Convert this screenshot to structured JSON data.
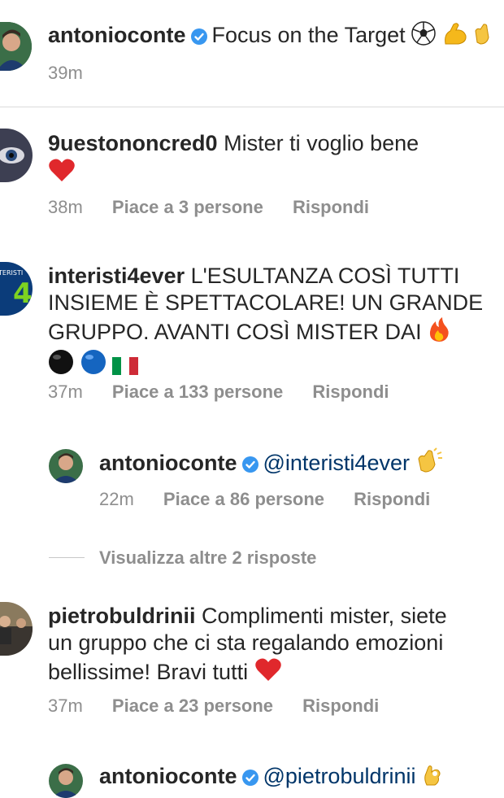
{
  "caption": {
    "username": "antonioconte",
    "text": "Focus on the Target",
    "time": "39m"
  },
  "comments": [
    {
      "username": "9uestononcred0",
      "text": "Mister ti voglio bene",
      "time": "38m",
      "likes": "Piace a 3 persone",
      "reply": "Rispondi"
    },
    {
      "username": "interisti4ever",
      "line1": "L'ESULTANZA COSÌ TUTTI",
      "line2": "INSIEME È SPETTACOLARE! UN GRANDE",
      "line3": "GRUPPO. AVANTI COSÌ MISTER DAI",
      "time": "37m",
      "likes": "Piace a 133 persone",
      "reply": "Rispondi"
    },
    {
      "username": "antonioconte",
      "mention": "@interisti4ever",
      "time": "22m",
      "likes": "Piace a 86 persone",
      "reply": "Rispondi"
    },
    {
      "username": "pietrobuldrinii",
      "line1": "Complimenti mister, siete",
      "line2": "un gruppo che ci sta regalando emozioni",
      "line3": "bellissime! Bravi tutti",
      "time": "37m",
      "likes": "Piace a 23 persone",
      "reply": "Rispondi"
    },
    {
      "username": "antonioconte",
      "mention": "@pietrobuldrinii"
    }
  ],
  "view_more": "Visualizza altre 2 risposte",
  "icons": [
    "verified-badge-icon",
    "soccer-ball-emoji",
    "flexed-biceps-emoji",
    "clapping-hands-emoji",
    "red-heart-emoji",
    "fire-emoji",
    "black-circle-emoji",
    "blue-circle-emoji",
    "italy-flag-emoji",
    "ok-hand-emoji"
  ],
  "colors": {
    "text": "#262626",
    "meta": "#8e8e8e",
    "mention": "#003569",
    "verified": "#3897f0"
  }
}
